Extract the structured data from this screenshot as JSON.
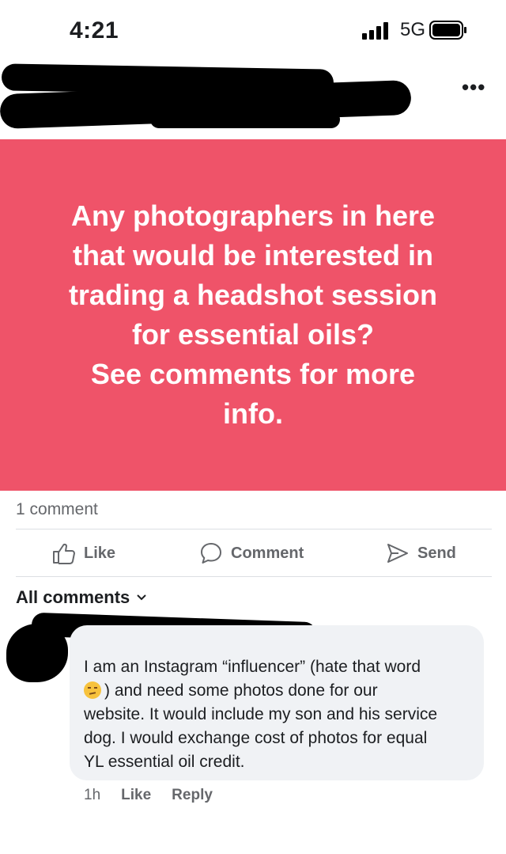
{
  "status_bar": {
    "time": "4:21",
    "network": "5G"
  },
  "post": {
    "lines": [
      "Any photographers in here",
      "that would be interested in",
      "trading a headshot session",
      "for essential oils?",
      "See comments for more",
      "info."
    ],
    "background_color": "#ef5369"
  },
  "stats": {
    "comment_count": "1 comment"
  },
  "actions": {
    "like": "Like",
    "comment": "Comment",
    "send": "Send"
  },
  "comments_header": {
    "label": "All comments"
  },
  "comment": {
    "lines": [
      "I am an Instagram “influencer” (hate that word",
      ") and need some photos done for our",
      "website. It would include my son and his service",
      "dog. I would exchange cost of photos for equal",
      "YL essential oil credit."
    ],
    "time": "1h",
    "like": "Like",
    "reply": "Reply"
  }
}
